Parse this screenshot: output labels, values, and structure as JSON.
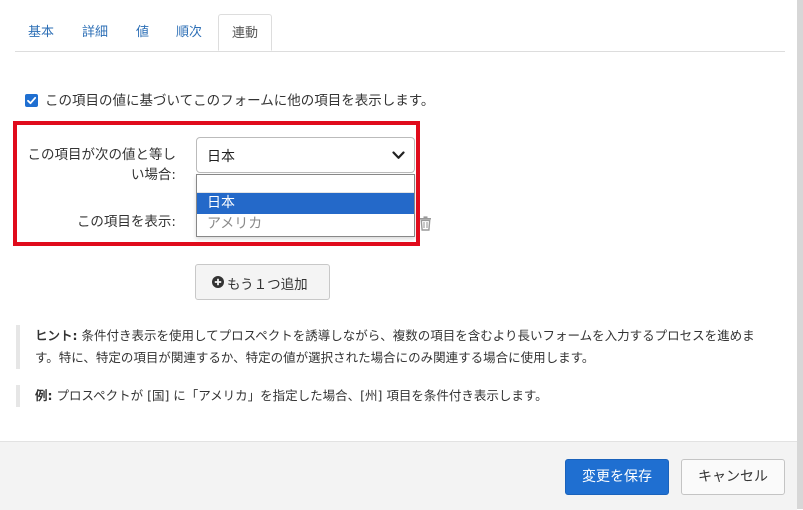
{
  "tabs": [
    {
      "label": "基本",
      "active": false
    },
    {
      "label": "詳細",
      "active": false
    },
    {
      "label": "値",
      "active": false
    },
    {
      "label": "順次",
      "active": false
    },
    {
      "label": "連動",
      "active": true
    }
  ],
  "dependency": {
    "checkbox_checked": true,
    "checkbox_label": "この項目の値に基づいてこのフォームに他の項目を表示します。",
    "condition_label_line1": "この項目が次の値と等し",
    "condition_label_line2": "い場合:",
    "selected_value": "日本",
    "options": [
      "日本",
      "アメリカ"
    ],
    "show_label": "この項目を表示:",
    "add_button_label": "もう１つ追加"
  },
  "hints": {
    "hint_title": "ヒント:",
    "hint_line1": "条件付き表示を使用してプロスペクトを誘導しながら、複数の項目を含むより長いフォームを入力するプロセスを進めま",
    "hint_line2": "す。特に、特定の項目が関連するか、特定の値が選択された場合にのみ関連する場合に使用します。",
    "example_title": "例:",
    "example_text": "プロスペクトが [国] に「アメリカ」を指定した場合、[州] 項目を条件付き表示します。"
  },
  "footer": {
    "save_label": "変更を保存",
    "cancel_label": "キャンセル"
  },
  "colors": {
    "primary": "#1f6fd1",
    "highlight_border": "#e00b1c",
    "tab_link": "#2d6fb6",
    "option_selected_bg": "#2469c9"
  },
  "icons": [
    "check-icon",
    "chevron-down-icon",
    "trash-icon",
    "plus-circle-icon"
  ]
}
